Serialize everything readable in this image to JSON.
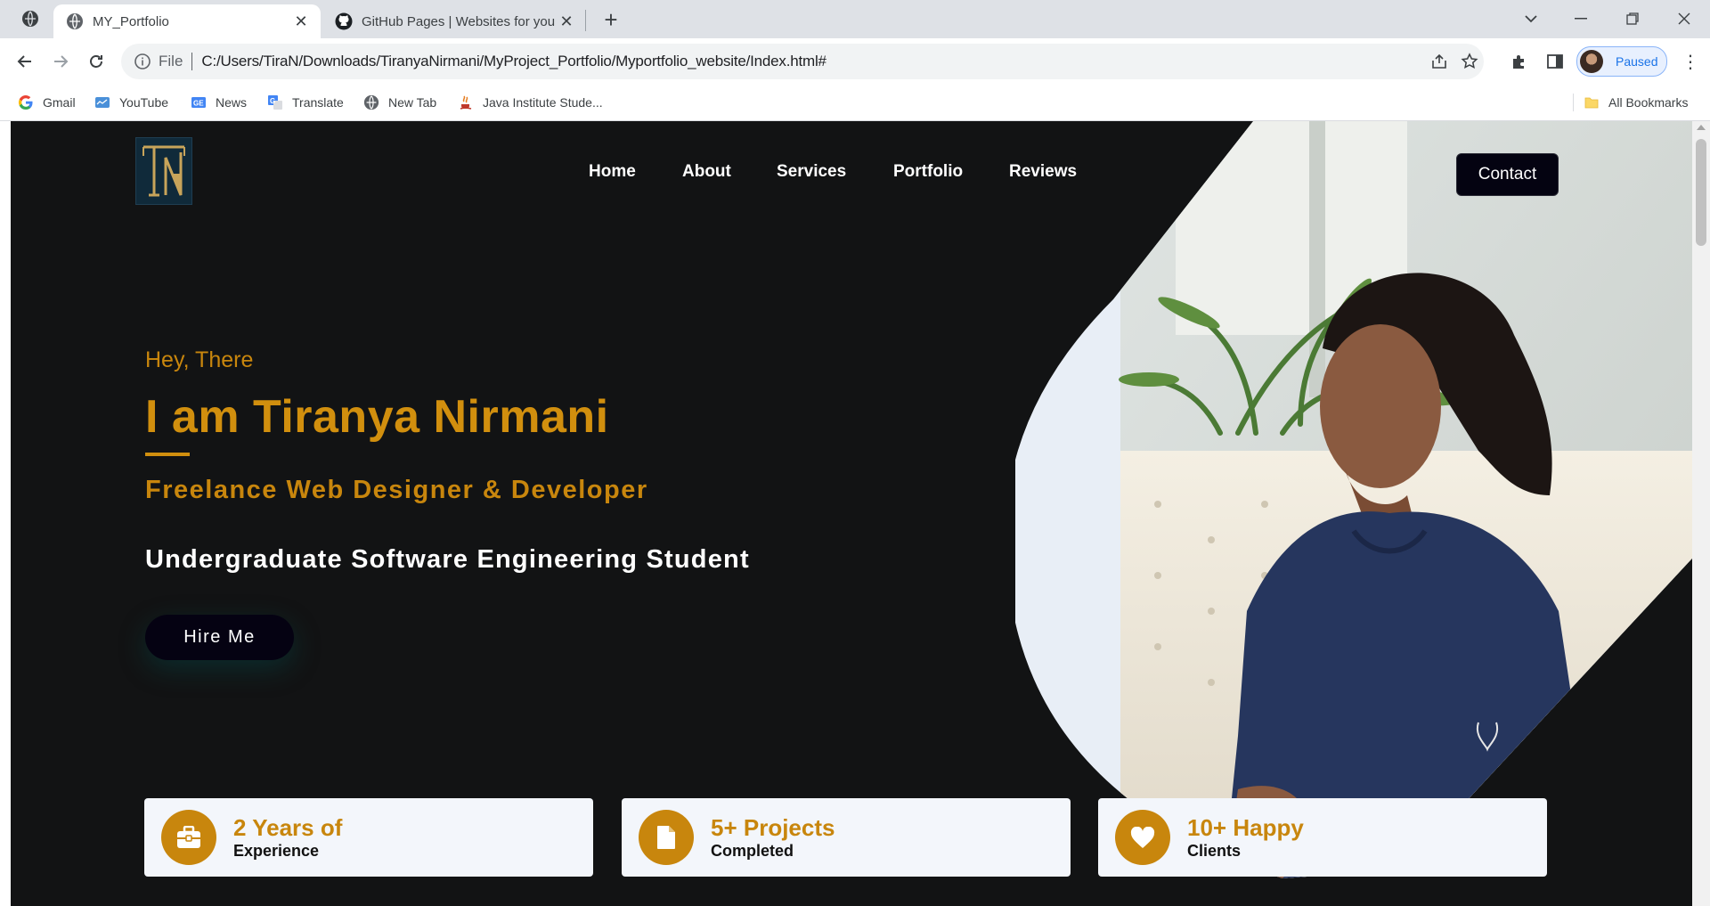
{
  "browser": {
    "tabs": [
      {
        "title": "MY_Portfolio",
        "icon": "globe-icon",
        "active": true
      },
      {
        "title": "GitHub Pages | Websites for you",
        "icon": "github-icon",
        "active": false
      }
    ],
    "address": {
      "scheme_label": "File",
      "url": "C:/Users/TiraN/Downloads/TiranyaNirmani/MyProject_Portfolio/Myportfolio_website/Index.html#"
    },
    "profile_label": "Paused",
    "bookmarks": [
      {
        "label": "Gmail",
        "icon": "google-icon"
      },
      {
        "label": "YouTube",
        "icon": "youtube-icon"
      },
      {
        "label": "News",
        "icon": "news-icon"
      },
      {
        "label": "Translate",
        "icon": "translate-icon"
      },
      {
        "label": "New Tab",
        "icon": "globe-icon"
      },
      {
        "label": "Java Institute Stude...",
        "icon": "java-institute-icon"
      }
    ],
    "all_bookmarks_label": "All Bookmarks"
  },
  "site": {
    "nav": [
      "Home",
      "About",
      "Services",
      "Portfolio",
      "Reviews"
    ],
    "contact_label": "Contact",
    "hero": {
      "greeting": "Hey, There",
      "name": "I am Tiranya Nirmani",
      "role": "Freelance Web Designer & Developer",
      "subtitle": "Undergraduate Software Engineering Student",
      "cta": "Hire Me"
    },
    "stats": [
      {
        "title": "2 Years of",
        "subtitle": "Experience",
        "icon": "briefcase-icon"
      },
      {
        "title": "5+ Projects",
        "subtitle": "Completed",
        "icon": "document-icon"
      },
      {
        "title": "10+ Happy",
        "subtitle": "Clients",
        "icon": "heart-icon"
      }
    ]
  },
  "colors": {
    "accent": "#c8860d",
    "page_bg": "#121314",
    "button_bg": "#050212",
    "card_bg": "#f3f6fb"
  }
}
